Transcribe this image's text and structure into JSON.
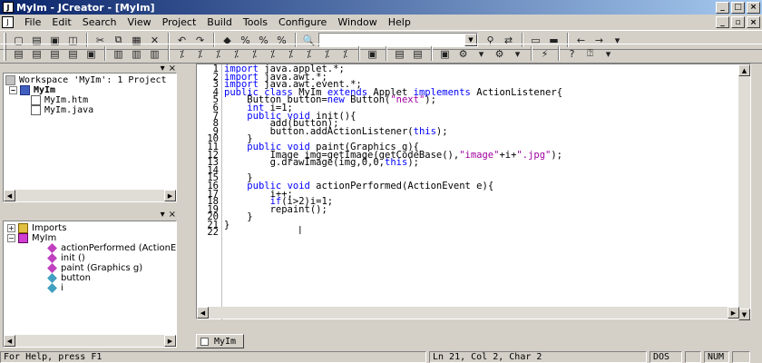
{
  "window": {
    "title": "MyIm - JCreator - [MyIm]"
  },
  "menu": [
    "File",
    "Edit",
    "Search",
    "View",
    "Project",
    "Build",
    "Tools",
    "Configure",
    "Window",
    "Help"
  ],
  "workspace": {
    "title": "Workspace 'MyIm': 1 Project",
    "project": "MyIm",
    "files": [
      "MyIm.htm",
      "MyIm.java"
    ]
  },
  "classview": {
    "imports": "Imports",
    "class": "MyIm",
    "members": [
      "actionPerformed (ActionE",
      "init ()",
      "paint (Graphics g)",
      "button",
      "i"
    ]
  },
  "editor": {
    "lines": [
      "import java.applet.*;",
      "import java.awt.*;",
      "import java.awt.event.*;",
      "public class MyIm extends Applet implements ActionListener{",
      "    Button button=new Button(\"next\");",
      "    int i=1;",
      "    public void init(){",
      "        add(button);",
      "        button.addActionListener(this);",
      "    }",
      "    public void paint(Graphics g){",
      "        Image img=getImage(getCodeBase(),\"image\"+i+\".jpg\");",
      "        g.drawImage(img,0,0,this);",
      "",
      "    }",
      "    public void actionPerformed(ActionEvent e){",
      "        i++;",
      "        if(i>2)i=1;",
      "        repaint();",
      "    }",
      "}",
      ""
    ]
  },
  "tab": "MyIm",
  "status": {
    "help": "For Help, press F1",
    "pos": "Ln 21, Col 2, Char 2",
    "mode": "DOS",
    "num": "NUM"
  }
}
